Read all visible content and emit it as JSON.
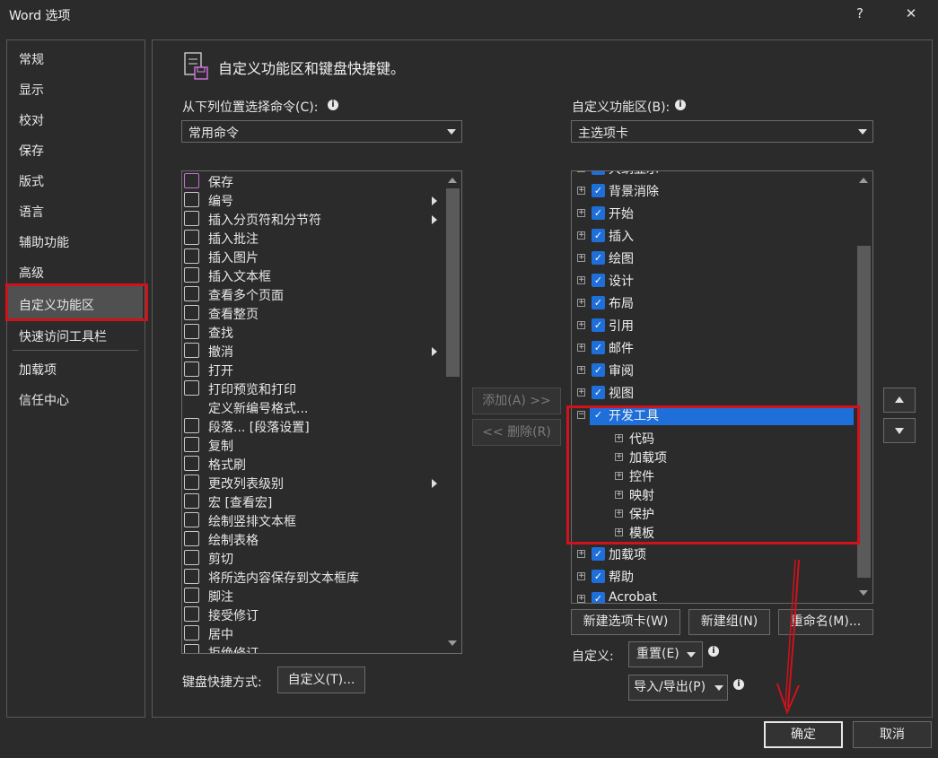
{
  "window": {
    "title": "Word 选项",
    "help": "?",
    "close": "✕"
  },
  "nav": {
    "items": [
      "常规",
      "显示",
      "校对",
      "保存",
      "版式",
      "语言",
      "辅助功能",
      "高级",
      "自定义功能区",
      "快速访问工具栏",
      "加载项",
      "信任中心"
    ],
    "selected": "自定义功能区"
  },
  "header": {
    "title": "自定义功能区和键盘快捷键。"
  },
  "left_panel": {
    "label": "从下列位置选择命令(C):",
    "combo_value": "常用命令",
    "commands": [
      {
        "label": "保存",
        "icon": "save-icon",
        "submenu": false
      },
      {
        "label": "编号",
        "icon": "numbering-icon",
        "submenu": true
      },
      {
        "label": "插入分页符和分节符",
        "icon": "page-break-icon",
        "submenu": true
      },
      {
        "label": "插入批注",
        "icon": "comment-icon",
        "submenu": false
      },
      {
        "label": "插入图片",
        "icon": "picture-icon",
        "submenu": false
      },
      {
        "label": "插入文本框",
        "icon": "textbox-icon",
        "submenu": false
      },
      {
        "label": "查看多个页面",
        "icon": "multiple-pages-icon",
        "submenu": false
      },
      {
        "label": "查看整页",
        "icon": "whole-page-icon",
        "submenu": false
      },
      {
        "label": "查找",
        "icon": "find-icon",
        "submenu": false
      },
      {
        "label": "撤消",
        "icon": "undo-icon",
        "submenu": true
      },
      {
        "label": "打开",
        "icon": "open-icon",
        "submenu": false
      },
      {
        "label": "打印预览和打印",
        "icon": "print-preview-icon",
        "submenu": false
      },
      {
        "label": "定义新编号格式...",
        "icon": "",
        "submenu": false
      },
      {
        "label": "段落... [段落设置]",
        "icon": "paragraph-icon",
        "submenu": false
      },
      {
        "label": "复制",
        "icon": "copy-icon",
        "submenu": false
      },
      {
        "label": "格式刷",
        "icon": "format-painter-icon",
        "submenu": false
      },
      {
        "label": "更改列表级别",
        "icon": "list-level-icon",
        "submenu": true
      },
      {
        "label": "宏 [查看宏]",
        "icon": "macro-icon",
        "submenu": false
      },
      {
        "label": "绘制竖排文本框",
        "icon": "vertical-textbox-icon",
        "submenu": false
      },
      {
        "label": "绘制表格",
        "icon": "draw-table-icon",
        "submenu": false
      },
      {
        "label": "剪切",
        "icon": "cut-icon",
        "submenu": false
      },
      {
        "label": "将所选内容保存到文本框库",
        "icon": "save-selection-icon",
        "submenu": false
      },
      {
        "label": "脚注",
        "icon": "footnote-icon",
        "submenu": false
      },
      {
        "label": "接受修订",
        "icon": "accept-revision-icon",
        "submenu": false
      },
      {
        "label": "居中",
        "icon": "center-icon",
        "submenu": false
      },
      {
        "label": "拒绝修订",
        "icon": "reject-revision-icon",
        "submenu": false
      }
    ],
    "keyboard_label": "键盘快捷方式:",
    "keyboard_button": "自定义(T)..."
  },
  "middle": {
    "add_button": "添加(A) >>",
    "remove_button": "<< 删除(R)"
  },
  "right_panel": {
    "label": "自定义功能区(B):",
    "combo_value": "主选项卡",
    "tabs": [
      {
        "label": "大纲显示",
        "checked": true,
        "expanded": false,
        "partial": true
      },
      {
        "label": "背景消除",
        "checked": true,
        "expanded": false
      },
      {
        "label": "开始",
        "checked": true,
        "expanded": false
      },
      {
        "label": "插入",
        "checked": true,
        "expanded": false
      },
      {
        "label": "绘图",
        "checked": true,
        "expanded": false
      },
      {
        "label": "设计",
        "checked": true,
        "expanded": false
      },
      {
        "label": "布局",
        "checked": true,
        "expanded": false
      },
      {
        "label": "引用",
        "checked": true,
        "expanded": false
      },
      {
        "label": "邮件",
        "checked": true,
        "expanded": false
      },
      {
        "label": "审阅",
        "checked": true,
        "expanded": false
      },
      {
        "label": "视图",
        "checked": true,
        "expanded": false
      },
      {
        "label": "开发工具",
        "checked": true,
        "expanded": true,
        "selected": true,
        "groups": [
          "代码",
          "加载项",
          "控件",
          "映射",
          "保护",
          "模板"
        ]
      },
      {
        "label": "加载项",
        "checked": true,
        "expanded": false
      },
      {
        "label": "帮助",
        "checked": true,
        "expanded": false
      },
      {
        "label": "Acrobat",
        "checked": true,
        "expanded": false
      }
    ],
    "new_tab_button": "新建选项卡(W)",
    "new_group_button": "新建组(N)",
    "rename_button": "重命名(M)...",
    "customize_label": "自定义:",
    "reset_button": "重置(E)",
    "import_export_button": "导入/导出(P)"
  },
  "footer": {
    "ok_button": "确定",
    "cancel_button": "取消"
  },
  "colors": {
    "accent": "#1e6fd9",
    "annotation_red": "#d0121b"
  }
}
